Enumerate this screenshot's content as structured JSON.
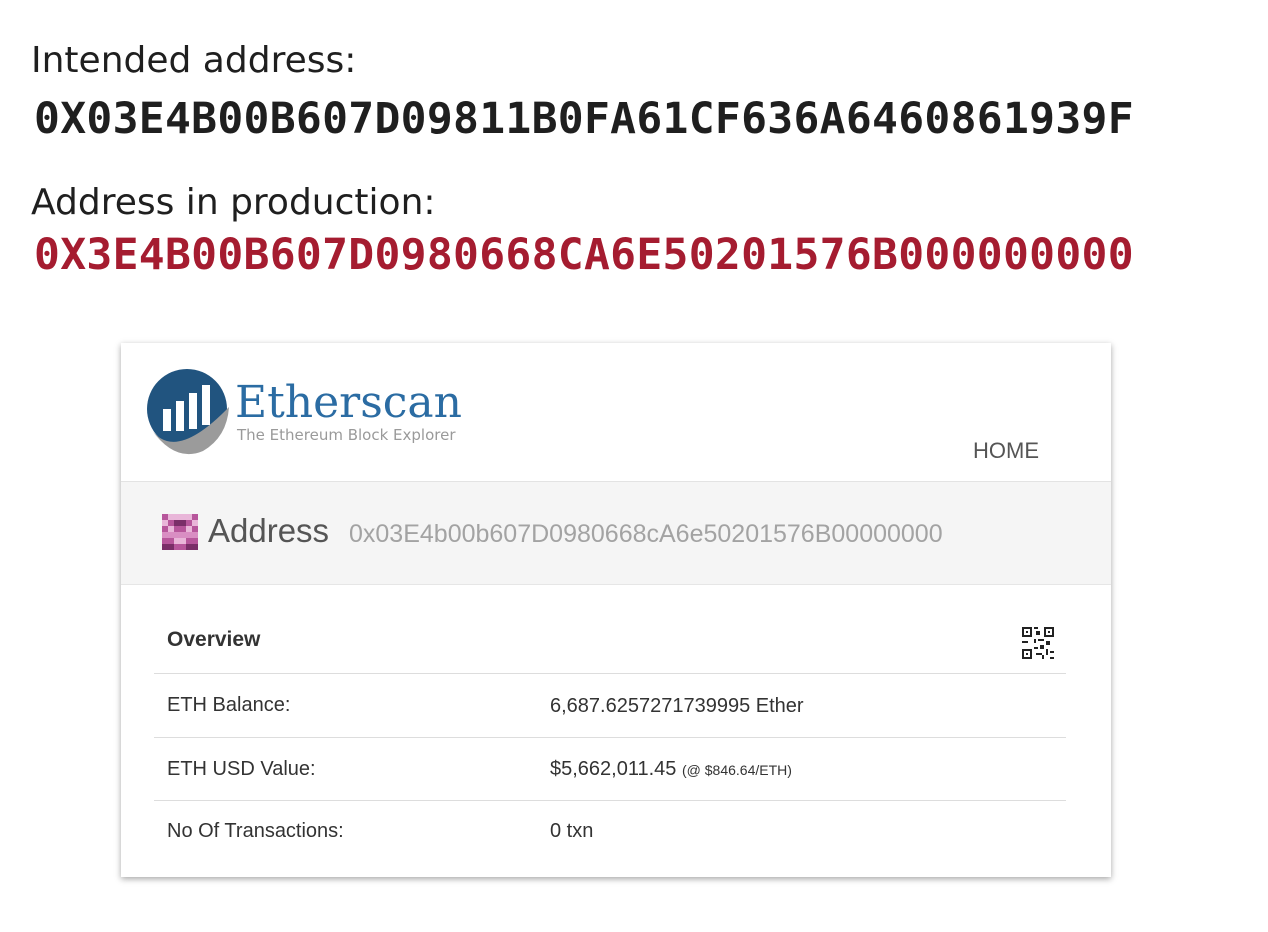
{
  "intended": {
    "label": "Intended address:",
    "address": "0X03E4B00B607D09811B0FA61CF636A6460861939F",
    "color": "#1f1f1f"
  },
  "production": {
    "label": "Address in production:",
    "address": "0X3E4B00B607D0980668CA6E50201576B000000000",
    "color": "#a51c30"
  },
  "etherscan": {
    "logo": {
      "name": "Etherscan",
      "tagline": "The Ethereum Block Explorer",
      "icon": "etherscan-logo-icon",
      "brand_color": "#2b6ca3"
    },
    "nav": {
      "home": "HOME"
    },
    "address_panel": {
      "icon": "identicon-icon",
      "title": "Address",
      "address": "0x03E4b00b607D0980668cA6e50201576B00000000"
    },
    "overview": {
      "title": "Overview",
      "qr_icon": "qr-code-icon",
      "rows": [
        {
          "label": "ETH Balance:",
          "value": "6,687.6257271739995 Ether",
          "note": ""
        },
        {
          "label": "ETH USD Value:",
          "value": "$5,662,011.45",
          "note": "(@ $846.64/ETH)"
        },
        {
          "label": "No Of Transactions:",
          "value": "0 txn",
          "note": ""
        }
      ]
    }
  }
}
